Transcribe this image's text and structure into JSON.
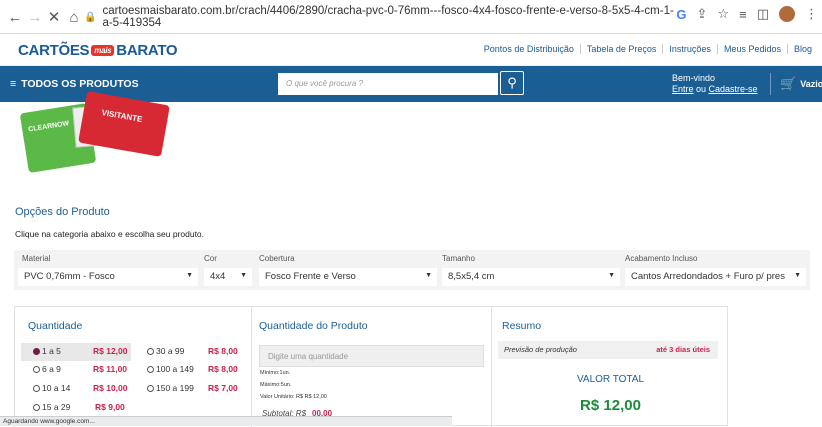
{
  "browser": {
    "url": "cartoesmaisbarato.com.br/crach/4406/2890/cracha-pvc-0-76mm---fosco-4x4-fosco-frente-e-verso-8-5x5-4-cm-1-a-5-419354",
    "status": "Aguardando www.google.com..."
  },
  "header": {
    "logo_left": "CARTÕES",
    "logo_mais": "mais",
    "logo_right": "BARATO",
    "links": [
      "Pontos de Distribuição",
      "Tabela de Preços",
      "Instruções",
      "Meus Pedidos",
      "Blog"
    ]
  },
  "mainbar": {
    "all_products": "TODOS OS PRODUTOS",
    "search_placeholder": "O que você procura ?",
    "welcome": "Bem-vindo",
    "login": "Entre",
    "or": " ou ",
    "register": "Cadastre-se",
    "cart": "Vazio"
  },
  "product_image": {
    "card1": "CLEARNOW",
    "card2": "VISITANTE"
  },
  "options": {
    "title": "Opções do Produto",
    "subtitle": "Clique na categoria abaixo e escolha seu produto.",
    "fields": [
      {
        "label": "Material",
        "value": "PVC 0,76mm - Fosco"
      },
      {
        "label": "Cor",
        "value": "4x4"
      },
      {
        "label": "Cobertura",
        "value": "Fosco Frente e Verso"
      },
      {
        "label": "Tamanho",
        "value": "8,5x5,4 cm"
      },
      {
        "label": "Acabamento Incluso",
        "value": "Cantos Arredondados + Furo p/ pres"
      }
    ]
  },
  "quantity": {
    "title": "Quantidade",
    "options": [
      {
        "range": "1 a 5",
        "price": "R$ 12,00",
        "selected": true
      },
      {
        "range": "30 a 99",
        "price": "R$ 8,00",
        "selected": false
      },
      {
        "range": "6 a 9",
        "price": "R$ 11,00",
        "selected": false
      },
      {
        "range": "100 a 149",
        "price": "R$ 8,00",
        "selected": false
      },
      {
        "range": "10 a 14",
        "price": "R$ 10,00",
        "selected": false
      },
      {
        "range": "150 a 199",
        "price": "R$ 7,00",
        "selected": false
      },
      {
        "range": "15 a 29",
        "price": "R$ 9,00",
        "selected": false
      }
    ]
  },
  "product_quantity": {
    "title": "Quantidade do Produto",
    "placeholder": "Digite uma quantidade",
    "min": "Mínimo:1un.",
    "max": "Máximo:5un.",
    "unit_value": "Valor Unitário: R$ R$ 12,00",
    "subtotal_label": "Subtotal: R$",
    "subtotal_value": "00,00"
  },
  "summary": {
    "title": "Resumo",
    "production_label": "Previsão de produção",
    "production_value": "até 3 dias úteis",
    "total_label": "VALOR TOTAL",
    "total_value": "R$ 12,00"
  }
}
